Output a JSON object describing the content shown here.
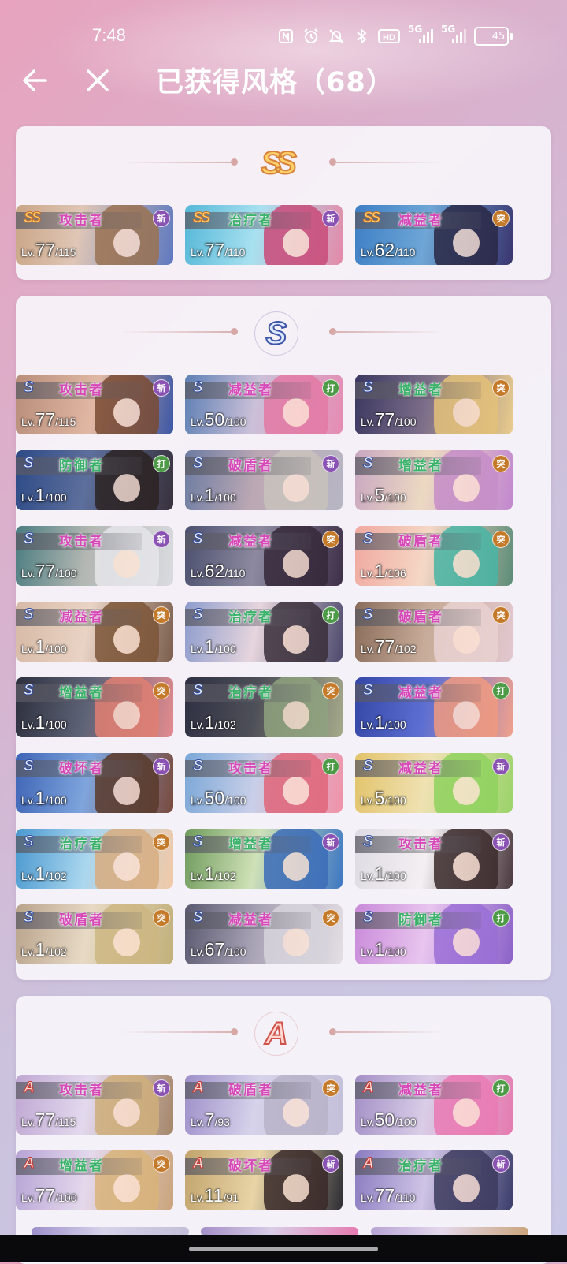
{
  "status": {
    "time": "7:48",
    "icons": [
      "nfc-icon",
      "alarm-icon",
      "mute-icon",
      "bluetooth-icon",
      "hd-icon",
      "signal-5g-icon",
      "signal-5g-icon",
      "battery-icon"
    ],
    "hd_label": "HD",
    "net1": "5G",
    "net2": "5G",
    "battery": "45",
    "battery_level": 0.45,
    "battery_color": "#e9c85a"
  },
  "header": {
    "title": "已获得风格（68）",
    "back_icon": "arrow-left-icon",
    "close_icon": "close-icon"
  },
  "colors": {
    "role_pink": "#d748b8",
    "role_green": "#3bb36b",
    "type_slash": "#8a53b3",
    "type_strike": "#4d9b46",
    "type_pierce": "#c57a2a"
  },
  "tiers": [
    {
      "badge": "SS",
      "cards": [
        {
          "rank": "SS",
          "role": "攻击者",
          "type": "斩",
          "lv": "Lv.",
          "cur": "77",
          "max": "/115"
        },
        {
          "rank": "SS",
          "role": "治疗者",
          "type": "斩",
          "lv": "Lv.",
          "cur": "77",
          "max": "/110"
        },
        {
          "rank": "SS",
          "role": "减益者",
          "type": "突",
          "lv": "Lv.",
          "cur": "62",
          "max": "/110"
        }
      ]
    },
    {
      "badge": "S",
      "cards": [
        {
          "rank": "S",
          "role": "攻击者",
          "type": "斩",
          "lv": "Lv.",
          "cur": "77",
          "max": "/115"
        },
        {
          "rank": "S",
          "role": "减益者",
          "type": "打",
          "lv": "Lv.",
          "cur": "50",
          "max": "/100"
        },
        {
          "rank": "S",
          "role": "增益者",
          "type": "突",
          "lv": "Lv.",
          "cur": "77",
          "max": "/100"
        },
        {
          "rank": "S",
          "role": "防御者",
          "type": "打",
          "lv": "Lv.",
          "cur": "1",
          "max": "/100"
        },
        {
          "rank": "S",
          "role": "破盾者",
          "type": "斩",
          "lv": "Lv.",
          "cur": "1",
          "max": "/100"
        },
        {
          "rank": "S",
          "role": "增益者",
          "type": "突",
          "lv": "Lv.",
          "cur": "5",
          "max": "/100"
        },
        {
          "rank": "S",
          "role": "攻击者",
          "type": "斩",
          "lv": "Lv.",
          "cur": "77",
          "max": "/100"
        },
        {
          "rank": "S",
          "role": "减益者",
          "type": "突",
          "lv": "Lv.",
          "cur": "62",
          "max": "/110"
        },
        {
          "rank": "S",
          "role": "破盾者",
          "type": "突",
          "lv": "Lv.",
          "cur": "1",
          "max": "/106"
        },
        {
          "rank": "S",
          "role": "减益者",
          "type": "突",
          "lv": "Lv.",
          "cur": "1",
          "max": "/100"
        },
        {
          "rank": "S",
          "role": "治疗者",
          "type": "打",
          "lv": "Lv.",
          "cur": "1",
          "max": "/100"
        },
        {
          "rank": "S",
          "role": "破盾者",
          "type": "突",
          "lv": "Lv.",
          "cur": "77",
          "max": "/102"
        },
        {
          "rank": "S",
          "role": "增益者",
          "type": "突",
          "lv": "Lv.",
          "cur": "1",
          "max": "/100"
        },
        {
          "rank": "S",
          "role": "治疗者",
          "type": "突",
          "lv": "Lv.",
          "cur": "1",
          "max": "/102"
        },
        {
          "rank": "S",
          "role": "减益者",
          "type": "打",
          "lv": "Lv.",
          "cur": "1",
          "max": "/100"
        },
        {
          "rank": "S",
          "role": "破坏者",
          "type": "斩",
          "lv": "Lv.",
          "cur": "1",
          "max": "/100"
        },
        {
          "rank": "S",
          "role": "攻击者",
          "type": "打",
          "lv": "Lv.",
          "cur": "50",
          "max": "/100"
        },
        {
          "rank": "S",
          "role": "减益者",
          "type": "斩",
          "lv": "Lv.",
          "cur": "5",
          "max": "/100"
        },
        {
          "rank": "S",
          "role": "治疗者",
          "type": "突",
          "lv": "Lv.",
          "cur": "1",
          "max": "/102"
        },
        {
          "rank": "S",
          "role": "增益者",
          "type": "斩",
          "lv": "Lv.",
          "cur": "1",
          "max": "/102"
        },
        {
          "rank": "S",
          "role": "攻击者",
          "type": "斩",
          "lv": "Lv.",
          "cur": "1",
          "max": "/100"
        },
        {
          "rank": "S",
          "role": "破盾者",
          "type": "突",
          "lv": "Lv.",
          "cur": "1",
          "max": "/102"
        },
        {
          "rank": "S",
          "role": "减益者",
          "type": "突",
          "lv": "Lv.",
          "cur": "67",
          "max": "/100"
        },
        {
          "rank": "S",
          "role": "防御者",
          "type": "打",
          "lv": "Lv.",
          "cur": "1",
          "max": "/100"
        }
      ]
    },
    {
      "badge": "A",
      "cards": [
        {
          "rank": "A",
          "role": "攻击者",
          "type": "斩",
          "lv": "Lv.",
          "cur": "77",
          "max": "/115"
        },
        {
          "rank": "A",
          "role": "破盾者",
          "type": "突",
          "lv": "Lv.",
          "cur": "7",
          "max": "/93"
        },
        {
          "rank": "A",
          "role": "减益者",
          "type": "打",
          "lv": "Lv.",
          "cur": "50",
          "max": "/100"
        },
        {
          "rank": "A",
          "role": "增益者",
          "type": "突",
          "lv": "Lv.",
          "cur": "77",
          "max": "/100"
        },
        {
          "rank": "A",
          "role": "破坏者",
          "type": "斩",
          "lv": "Lv.",
          "cur": "11",
          "max": "/91"
        },
        {
          "rank": "A",
          "role": "治疗者",
          "type": "斩",
          "lv": "Lv.",
          "cur": "77",
          "max": "/110"
        }
      ]
    }
  ]
}
